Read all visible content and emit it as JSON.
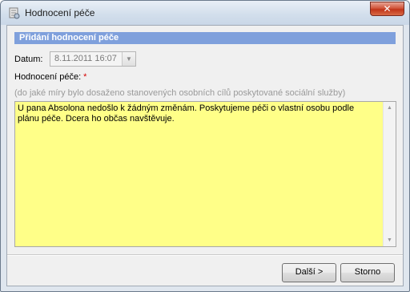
{
  "window": {
    "title": "Hodnocení péče",
    "close_label": "✕"
  },
  "section": {
    "header": "Přidání hodnocení péče"
  },
  "form": {
    "date_label": "Datum:",
    "date_value": "8.11.2011 16:07",
    "date_dropdown_glyph": "▼",
    "evaluation_label": "Hodnocení péče:",
    "required_mark": "*",
    "hint": "(do jaké míry bylo dosaženo stanovených osobních cílů poskytované sociální služby)",
    "evaluation_text": "U pana Absolona nedošlo k žádným změnám. Poskytujeme péči o vlastní osobu podle plánu péče. Dcera ho občas navštěvuje."
  },
  "buttons": {
    "next_label": "Další >",
    "cancel_label": "Storno"
  },
  "colors": {
    "section_header": "#7fa0dc",
    "textarea_background": "#ffff88",
    "required_mark": "#d40000"
  }
}
